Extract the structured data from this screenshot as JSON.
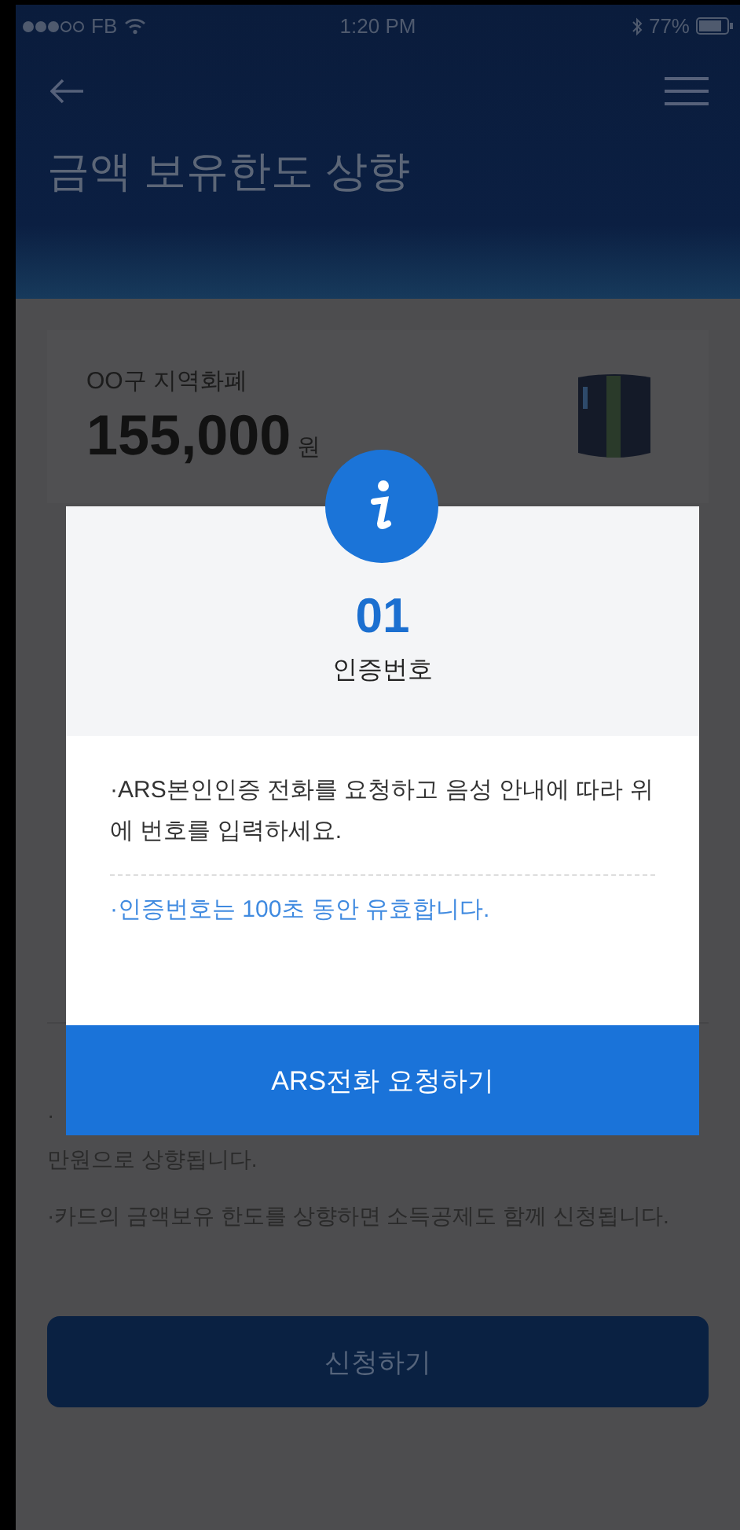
{
  "status_bar": {
    "carrier": "FB",
    "time": "1:20 PM",
    "battery": "77%"
  },
  "header": {
    "title": "금액 보유한도 상향"
  },
  "card": {
    "name": "OO구 지역화폐",
    "amount": "155,000",
    "unit": "원"
  },
  "notes": [
    "·",
    "만원으로 상향됩니다.",
    "·카드의 금액보유 한도를 상향하면 소득공제도 함께 신청됩니다."
  ],
  "submit_button": "신청하기",
  "dialog": {
    "code": "01",
    "code_label": "인증번호",
    "instructions": "·ARS본인인증 전화를 요청하고 음성 안내에 따라 위에 번호를 입력하세요.",
    "validity": "·인증번호는 100초 동안 유효합니다.",
    "button": "ARS전화 요청하기"
  }
}
